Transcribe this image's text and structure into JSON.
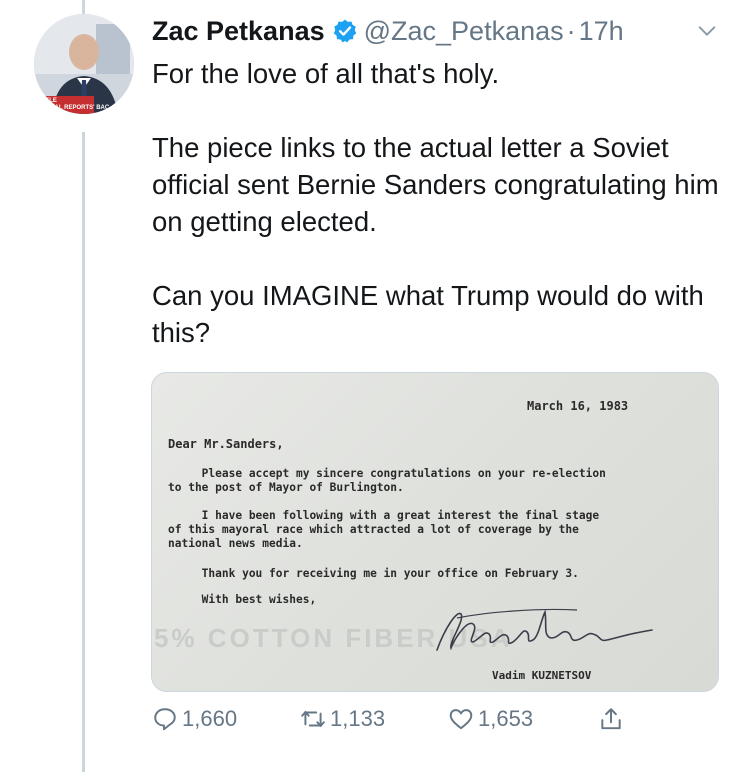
{
  "tweet": {
    "author_name": "Zac Petkanas",
    "handle": "@Zac_Petkanas",
    "separator": "·",
    "time": "17h",
    "paragraphs": [
      "For the love of all that's holy.",
      "The piece links to the actual letter a Soviet official sent Bernie Sanders congratulating him on getting elected.",
      "Can you IMAGINE what Trump would do with this?"
    ],
    "avatar_overlay_text": [
      "ATTLE",
      "MENTAL REPORTS' BAC"
    ]
  },
  "letter": {
    "date": "March 16, 1983",
    "salutation": "Dear Mr.Sanders,",
    "para1_l1": "     Please accept my sincere congratulations on your re-election",
    "para1_l2": "to the post of Mayor of Burlington.",
    "para2_l1": "     I have been following with a great interest the final stage",
    "para2_l2": "of this mayoral race which attracted a lot of coverage by the",
    "para2_l3": "national news media.",
    "para3": "     Thank you for receiving me in your office on February 3.",
    "closing": "     With best wishes,",
    "signatory": "Vadim KUZNETSOV",
    "watermark": "5% COTTON FIBER USA"
  },
  "actions": {
    "replies": "1,660",
    "retweets": "1,133",
    "likes": "1,653"
  },
  "colors": {
    "text": "#14171a",
    "secondary": "#657786",
    "verified": "#1da1f2",
    "border": "#ccd6dd"
  }
}
